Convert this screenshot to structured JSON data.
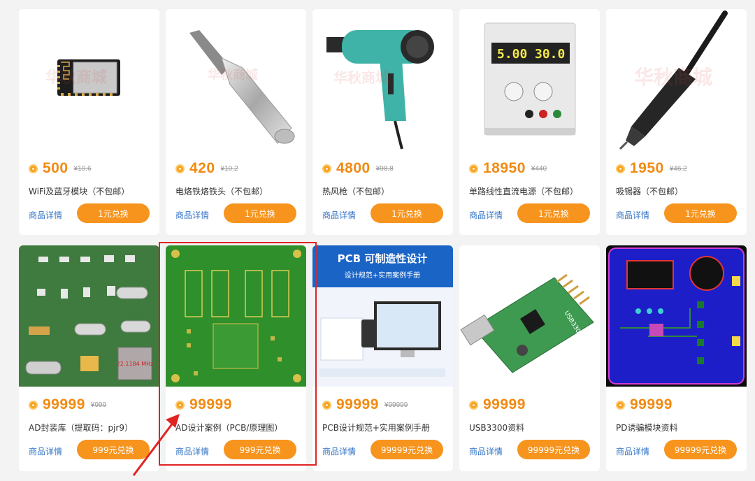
{
  "products": [
    {
      "points": "500",
      "original": "¥10.6",
      "name": "WiFi及蓝牙模块（不包邮）",
      "detail": "商品详情",
      "button": "1元兑换",
      "image": "wifi-module",
      "watermark": "华秋商城"
    },
    {
      "points": "420",
      "original": "¥10.2",
      "name": "电烙铁烙铁头（不包邮）",
      "detail": "商品详情",
      "button": "1元兑换",
      "image": "soldering-tip",
      "watermark": "华秋商城"
    },
    {
      "points": "4800",
      "original": "¥98.8",
      "name": "热风枪（不包邮）",
      "detail": "商品详情",
      "button": "1元兑换",
      "image": "heat-gun",
      "watermark": "华秋商城"
    },
    {
      "points": "18950",
      "original": "¥440",
      "name": "单路线性直流电源（不包邮）",
      "detail": "商品详情",
      "button": "1元兑换",
      "image": "power-supply",
      "display_v": "5.00",
      "display_a": "30.0"
    },
    {
      "points": "1950",
      "original": "¥46.2",
      "name": "吸锡器（不包邮）",
      "detail": "商品详情",
      "button": "1元兑换",
      "image": "desoldering-pump",
      "watermark": "华秋商城"
    },
    {
      "points": "99999",
      "original": "¥999",
      "name": "AD封装库（提取码：pjr9）",
      "detail": "商品详情",
      "button": "999元兑换",
      "image": "ad-footprints",
      "crystal_label": "22.1184 MHz"
    },
    {
      "points": "99999",
      "original": "",
      "name": "AD设计案例（PCB/原理图）",
      "detail": "商品详情",
      "button": "999元兑换",
      "image": "pcb-green"
    },
    {
      "points": "99999",
      "original": "¥99999",
      "name": "PCB设计规范+实用案例手册",
      "detail": "商品详情",
      "button": "99999元兑换",
      "image": "pcb-manual",
      "banner_title": "PCB 可制造性设计",
      "banner_sub": "设计规范+实用案例手册"
    },
    {
      "points": "99999",
      "original": "",
      "name": "USB3300资料",
      "detail": "商品详情",
      "button": "99999元兑换",
      "image": "usb3300-board",
      "chip_label": "USB3300"
    },
    {
      "points": "99999",
      "original": "",
      "name": "PD诱骗模块资料",
      "detail": "商品详情",
      "button": "99999元兑换",
      "image": "pd-module"
    }
  ],
  "colors": {
    "accent": "#f7941d",
    "price": "#f28a12",
    "link": "#3273c5",
    "highlight": "#e02424"
  }
}
